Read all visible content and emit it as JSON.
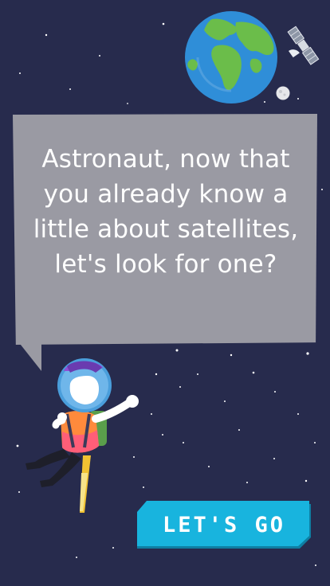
{
  "screen": {
    "background": "#272b4d"
  },
  "scene": {
    "earth_icon": "earth-globe-icon",
    "moon_icon": "moon-icon",
    "satellite_icon": "satellite-icon",
    "astronaut_icon": "astronaut-character"
  },
  "speech_bubble": {
    "text": "Astronaut, now that you already know a little about satellites, let's look for one?",
    "color": "#9a9aa3"
  },
  "cta": {
    "label": "LET'S GO",
    "color": "#18b4de",
    "shadow_color": "#0e7fa3"
  }
}
